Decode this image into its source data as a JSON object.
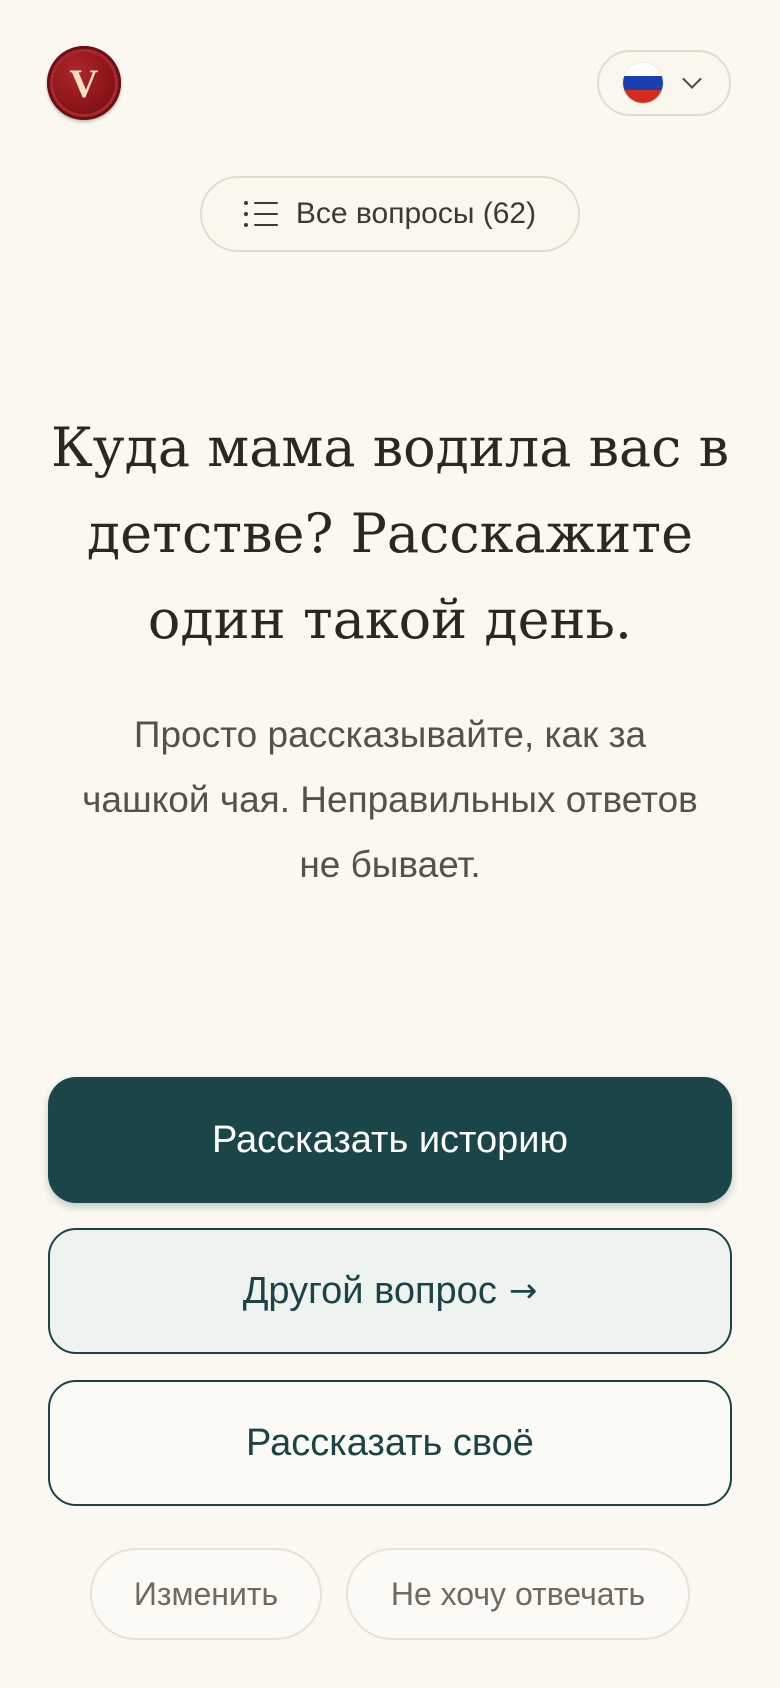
{
  "header": {
    "logo_letter": "V",
    "logo_icon": "wax-seal-logo",
    "language": {
      "flag_icon": "russia-flag-icon",
      "flag_colors": [
        "#ffffff",
        "#1c3fb0",
        "#d52b1e"
      ],
      "chevron_icon": "chevron-down-icon"
    }
  },
  "all_questions": {
    "icon": "list-icon",
    "label": "Все вопросы (62)"
  },
  "question": {
    "text": "Куда мама водила вас в детстве? Расскажите один такой день."
  },
  "hint": {
    "text": "Просто рассказывайте, как за чашкой чая. Неправильных ответов не бывает."
  },
  "actions": {
    "tell_story": "Рассказать историю",
    "another_question": "Другой вопрос",
    "another_question_arrow": "→",
    "tell_own": "Рассказать своё",
    "change": "Изменить",
    "skip": "Не хочу отвечать"
  },
  "colors": {
    "background": "#faf8f1",
    "primary": "#1b4649",
    "logo": "#8a1418"
  }
}
